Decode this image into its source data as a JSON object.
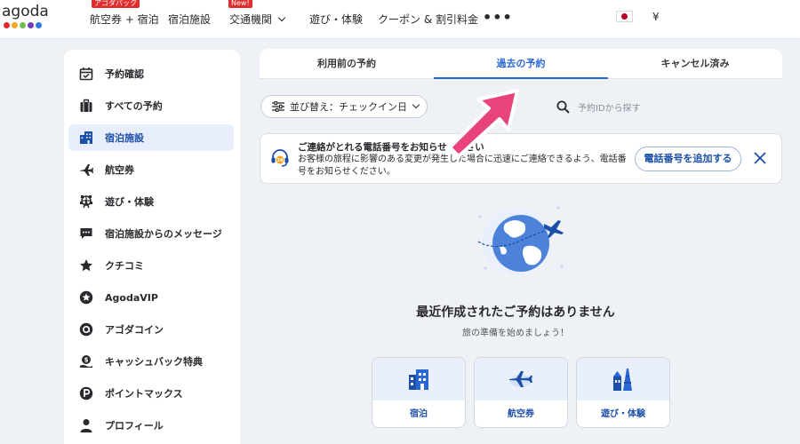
{
  "brand": {
    "logo_text": "agoda",
    "dot_colors": [
      "#e12d2d",
      "#f5a623",
      "#6cbf4a",
      "#6a3fb5",
      "#2d7be0"
    ]
  },
  "topnav": {
    "items": [
      {
        "label": "航空券 + 宿泊",
        "badge": "アゴダパック"
      },
      {
        "label": "宿泊施設",
        "badge": ""
      },
      {
        "label": "交通機関",
        "badge": "New!"
      },
      {
        "label": "遊び・体験",
        "badge": ""
      },
      {
        "label": "クーポン & 割引料金",
        "badge": ""
      }
    ],
    "more_label": "•••",
    "currency": "¥"
  },
  "sidebar": {
    "items": [
      {
        "label": "予約確認",
        "icon": "calendar-check-icon"
      },
      {
        "label": "すべての予約",
        "icon": "suitcase-icon"
      },
      {
        "label": "宿泊施設",
        "icon": "building-icon",
        "active": true
      },
      {
        "label": "航空券",
        "icon": "plane-icon"
      },
      {
        "label": "遊び・体験",
        "icon": "ferris-wheel-icon"
      },
      {
        "label": "宿泊施設からのメッセージ",
        "icon": "message-icon"
      },
      {
        "label": "クチコミ",
        "icon": "star-icon"
      },
      {
        "label": "AgodaVIP",
        "icon": "vip-star-icon"
      },
      {
        "label": "アゴダコイン",
        "icon": "coin-icon"
      },
      {
        "label": "キャッシュバック特典",
        "icon": "cashback-icon"
      },
      {
        "label": "ポイントマックス",
        "icon": "points-icon"
      },
      {
        "label": "プロフィール",
        "icon": "profile-icon"
      }
    ]
  },
  "tabs": [
    {
      "label": "利用前の予約"
    },
    {
      "label": "過去の予約",
      "active": true
    },
    {
      "label": "キャンセル済み"
    }
  ],
  "sort": {
    "label": "並び替え：チェックイン日"
  },
  "search": {
    "placeholder": "予約IDから探す"
  },
  "notice": {
    "title": "ご連絡がとれる電話番号をお知らせください",
    "body": "お客様の旅程に影響のある変更が発生した場合に迅速にご連絡できるよう、電話番号をお知らせください。",
    "add_button": "電話番号を追加する"
  },
  "empty_state": {
    "title": "最近作成されたご予約はありません",
    "subtitle": "旅の準備を始めましょう！"
  },
  "cards": [
    {
      "label": "宿泊",
      "icon": "hotel-icon"
    },
    {
      "label": "航空券",
      "icon": "airplane-icon"
    },
    {
      "label": "遊び・体験",
      "icon": "landmarks-icon"
    }
  ],
  "colors": {
    "accent": "#2967d4",
    "accent_dark": "#1c4fa8",
    "highlight_arrow": "#e8437a"
  }
}
